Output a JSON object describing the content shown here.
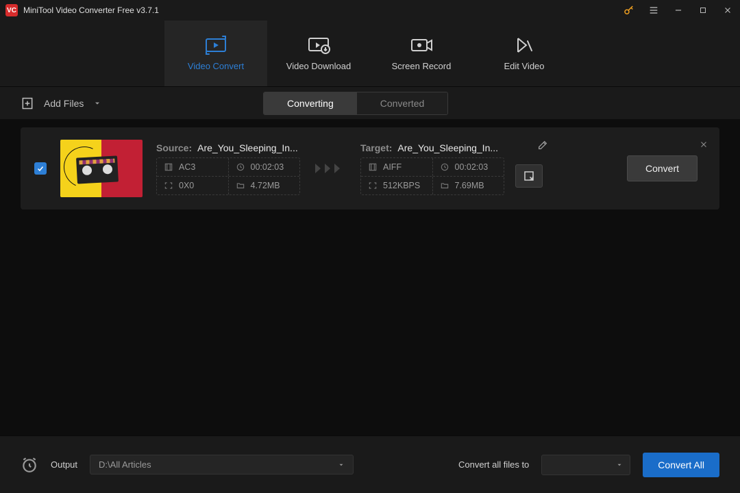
{
  "titlebar": {
    "appName": "MiniTool Video Converter Free v3.7.1"
  },
  "mainTabs": [
    {
      "label": "Video Convert",
      "active": true
    },
    {
      "label": "Video Download",
      "active": false
    },
    {
      "label": "Screen Record",
      "active": false
    },
    {
      "label": "Edit Video",
      "active": false
    }
  ],
  "toolbar": {
    "addFiles": "Add Files",
    "statusTabs": {
      "converting": "Converting",
      "converted": "Converted"
    }
  },
  "file": {
    "checked": true,
    "source": {
      "label": "Source:",
      "filename": "Are_You_Sleeping_In...",
      "codec": "AC3",
      "duration": "00:02:03",
      "resolution": "0X0",
      "size": "4.72MB"
    },
    "target": {
      "label": "Target:",
      "filename": "Are_You_Sleeping_In...",
      "codec": "AIFF",
      "duration": "00:02:03",
      "bitrate": "512KBPS",
      "size": "7.69MB"
    },
    "convertLabel": "Convert"
  },
  "footer": {
    "outputLabel": "Output",
    "outputPath": "D:\\All Articles",
    "convertToLabel": "Convert all files to",
    "convertAllLabel": "Convert All"
  }
}
